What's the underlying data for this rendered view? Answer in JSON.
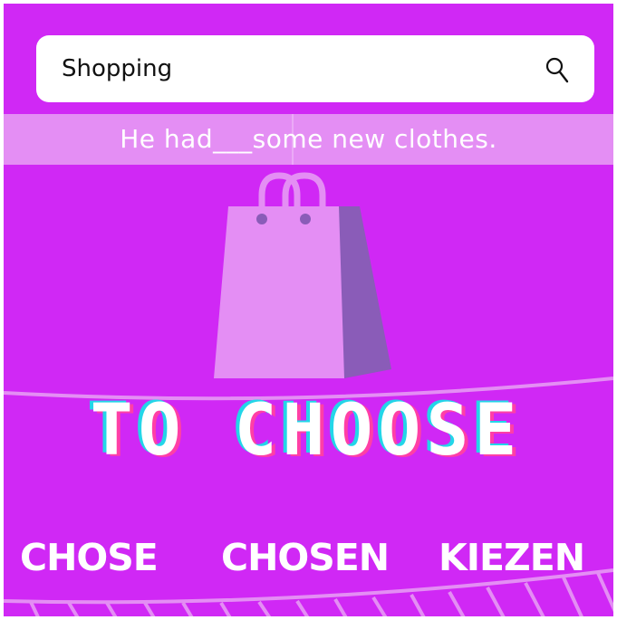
{
  "search": {
    "value": "Shopping",
    "icon": "search-icon"
  },
  "sentence": "He had___some new clothes.",
  "title": "TO CHOOSE",
  "options": [
    "CHOSE",
    "CHOSEN",
    "KIEZEN"
  ],
  "colors": {
    "background": "#d028f5",
    "band": "#e48ef4",
    "bag_front": "#e48ef4",
    "bag_side": "#8a5cb8",
    "title_fill": "#ffffff",
    "title_cyan": "#23d6e8",
    "title_pink": "#ff3fa6"
  }
}
